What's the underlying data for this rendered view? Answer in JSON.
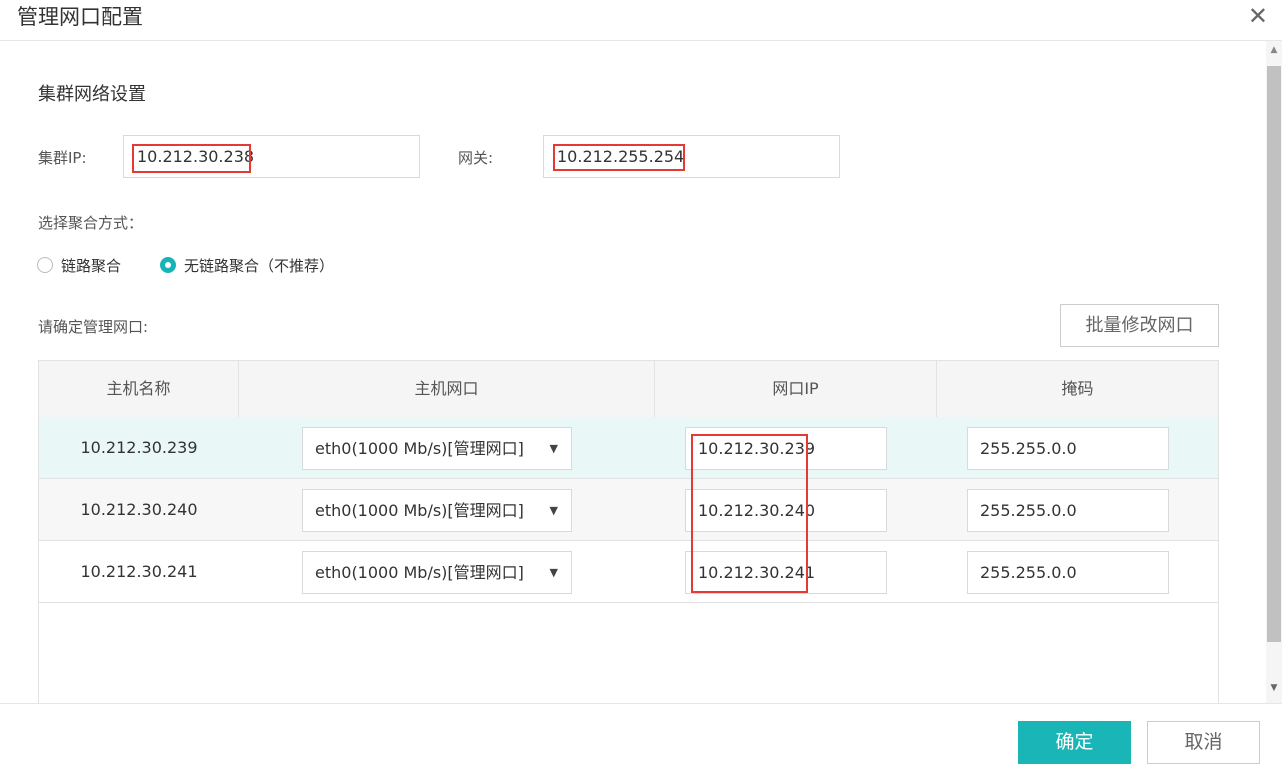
{
  "dialog": {
    "title": "管理网口配置",
    "close_glyph": "✕"
  },
  "section_title": "集群网络设置",
  "cluster_ip": {
    "label": "集群IP:",
    "value": "10.212.30.238"
  },
  "gateway": {
    "label": "网关:",
    "value": "10.212.255.254"
  },
  "aggregation": {
    "label": "选择聚合方式：",
    "options": [
      {
        "label": "链路聚合",
        "checked": false
      },
      {
        "label": "无链路聚合（不推荐）",
        "checked": true
      }
    ]
  },
  "nic_section": {
    "label": "请确定管理网口:",
    "batch_button": "批量修改网口"
  },
  "table": {
    "headers": [
      "主机名称",
      "主机网口",
      "网口IP",
      "掩码"
    ],
    "rows": [
      {
        "host": "10.212.30.239",
        "nic": "eth0(1000 Mb/s)[管理网口]",
        "ip": "10.212.30.239",
        "mask": "255.255.0.0"
      },
      {
        "host": "10.212.30.240",
        "nic": "eth0(1000 Mb/s)[管理网口]",
        "ip": "10.212.30.240",
        "mask": "255.255.0.0"
      },
      {
        "host": "10.212.30.241",
        "nic": "eth0(1000 Mb/s)[管理网口]",
        "ip": "10.212.30.241",
        "mask": "255.255.0.0"
      }
    ]
  },
  "footer": {
    "ok": "确定",
    "cancel": "取消"
  },
  "colors": {
    "accent": "#1ab6b7",
    "highlight_box": "#e53935",
    "selected_row": "#eaf7f7"
  },
  "icons": {
    "close": "close-icon",
    "dropdown": "caret-down-icon"
  }
}
